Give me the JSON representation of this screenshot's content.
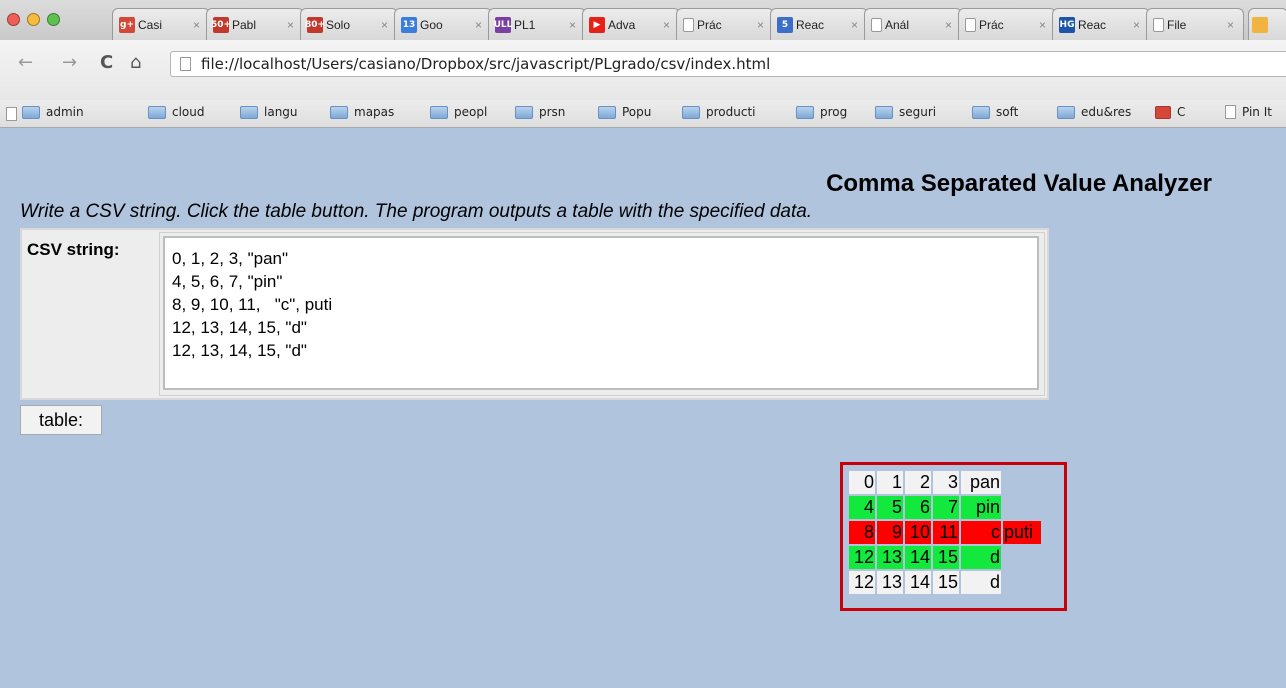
{
  "browser": {
    "tabs": [
      {
        "label": "Casi",
        "icon": "google-plus-icon",
        "color": "#d34836",
        "glyph": "g+"
      },
      {
        "label": "Pabl",
        "icon": "gmail-icon",
        "color": "#c0392b",
        "glyph": "50+"
      },
      {
        "label": "Solo",
        "icon": "gmail-icon",
        "color": "#c0392b",
        "glyph": "80+"
      },
      {
        "label": "Goo",
        "icon": "calendar-icon",
        "color": "#3b7ddd",
        "glyph": "13"
      },
      {
        "label": "PL1",
        "icon": "ull-icon",
        "color": "#7a3fa0",
        "glyph": "ULL"
      },
      {
        "label": "Adva",
        "icon": "youtube-icon",
        "color": "#e62117",
        "glyph": "▶"
      },
      {
        "label": "Prác",
        "icon": "page-icon",
        "color": "#ffffff",
        "glyph": ""
      },
      {
        "label": "Reac",
        "icon": "html5-icon",
        "color": "#3b6fc9",
        "glyph": "5"
      },
      {
        "label": "Anál",
        "icon": "page-icon",
        "color": "#ffffff",
        "glyph": ""
      },
      {
        "label": "Prác",
        "icon": "page-icon",
        "color": "#ffffff",
        "glyph": ""
      },
      {
        "label": "Reac",
        "icon": "hg-icon",
        "color": "#1a55a8",
        "glyph": "HG"
      },
      {
        "label": "File",
        "icon": "page-icon",
        "color": "#ffffff",
        "glyph": ""
      }
    ],
    "url": "file://localhost/Users/casiano/Dropbox/src/javascript/PLgrado/csv/index.html",
    "bookmarks": [
      {
        "label": "admin",
        "icon": "folder-icon"
      },
      {
        "label": "cloud",
        "icon": "folder-icon"
      },
      {
        "label": "langu",
        "icon": "folder-icon"
      },
      {
        "label": "mapas",
        "icon": "folder-icon"
      },
      {
        "label": "peopl",
        "icon": "folder-icon"
      },
      {
        "label": "prsn",
        "icon": "folder-icon"
      },
      {
        "label": "Popu",
        "icon": "folder-icon"
      },
      {
        "label": "producti",
        "icon": "folder-icon"
      },
      {
        "label": "prog",
        "icon": "folder-icon"
      },
      {
        "label": "seguri",
        "icon": "folder-icon"
      },
      {
        "label": "soft",
        "icon": "folder-icon"
      },
      {
        "label": "edu&res",
        "icon": "folder-icon"
      },
      {
        "label": "C",
        "icon": "google-plus-icon"
      },
      {
        "label": "Pin It",
        "icon": "page-icon"
      }
    ]
  },
  "page": {
    "title": "Comma Separated Value Analyzer",
    "instructions": "Write a CSV string. Click the table button. The program outputs a table with the specified data.",
    "form": {
      "label": "CSV string:",
      "value": "0, 1, 2, 3, \"pan\"\n4, 5, 6, 7, \"pin\"\n8, 9, 10, 11,   \"c\", puti\n12, 13, 14, 15, \"d\"\n12, 13, 14, 15, \"d\""
    },
    "button": {
      "label": "table:"
    },
    "output": {
      "border_color": "#c8000a",
      "rows": [
        {
          "status": "neutral",
          "color": "#f2f2f2",
          "cells": [
            "0",
            "1",
            "2",
            "3",
            "pan"
          ]
        },
        {
          "status": "ok",
          "color": "#13e93d",
          "cells": [
            "4",
            "5",
            "6",
            "7",
            "pin"
          ]
        },
        {
          "status": "error",
          "color": "#ff0000",
          "cells": [
            "8",
            "9",
            "10",
            "11",
            "c",
            "puti"
          ]
        },
        {
          "status": "ok",
          "color": "#13e93d",
          "cells": [
            "12",
            "13",
            "14",
            "15",
            "d"
          ]
        },
        {
          "status": "neutral",
          "color": "#f2f2f2",
          "cells": [
            "12",
            "13",
            "14",
            "15",
            "d"
          ]
        }
      ]
    }
  }
}
